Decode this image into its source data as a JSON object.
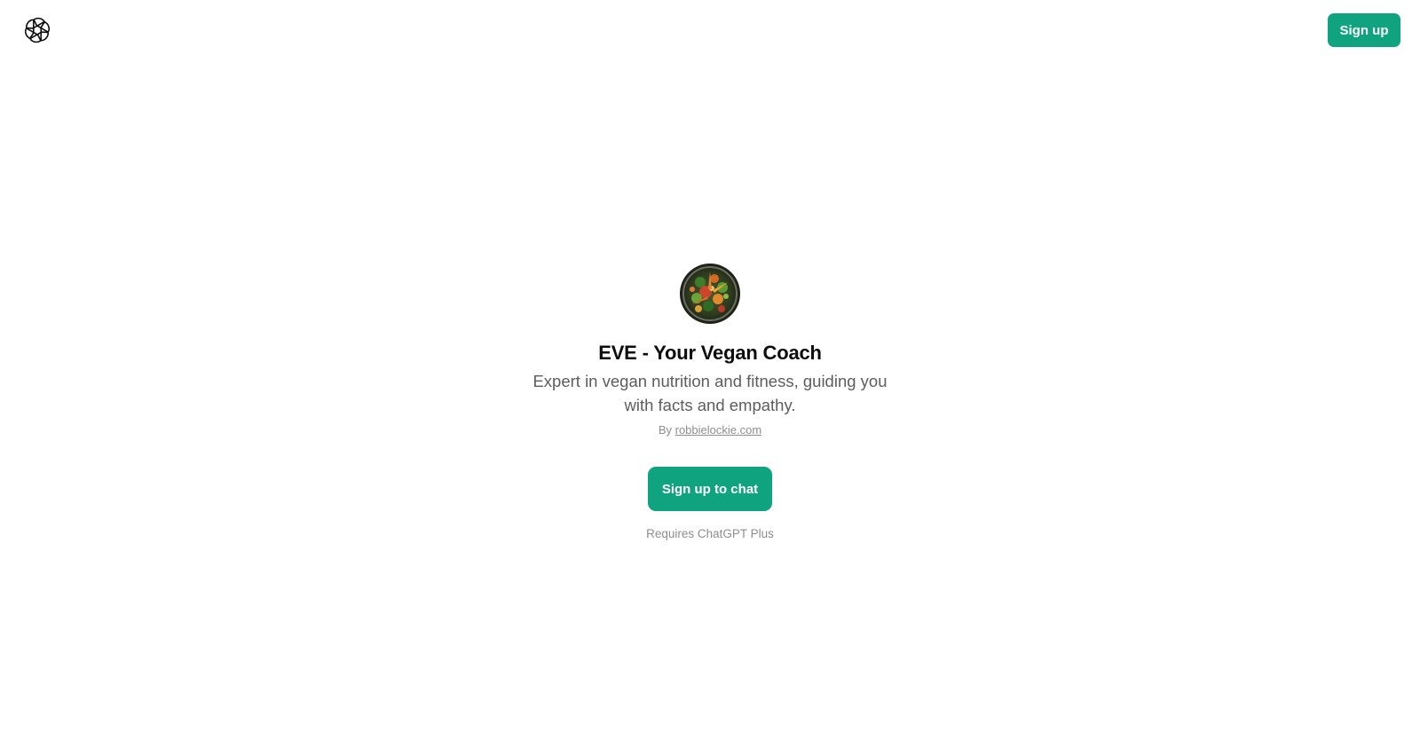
{
  "header": {
    "logo_icon": "openai-logo-icon",
    "signup_label": "Sign up"
  },
  "gpt": {
    "avatar": "vegan-food-plate-image",
    "name": "EVE - Your Vegan Coach",
    "description": "Expert in vegan nutrition and fitness, guiding you with facts and empathy.",
    "by_prefix": "By",
    "author": "robbielockie.com"
  },
  "cta": {
    "label": "Sign up to chat",
    "requirement": "Requires ChatGPT Plus"
  },
  "colors": {
    "accent": "#10a37f",
    "title": "#0d0d0d",
    "secondary_text": "#5d5d5d",
    "muted_text": "#8e8e8e",
    "background": "#ffffff"
  }
}
